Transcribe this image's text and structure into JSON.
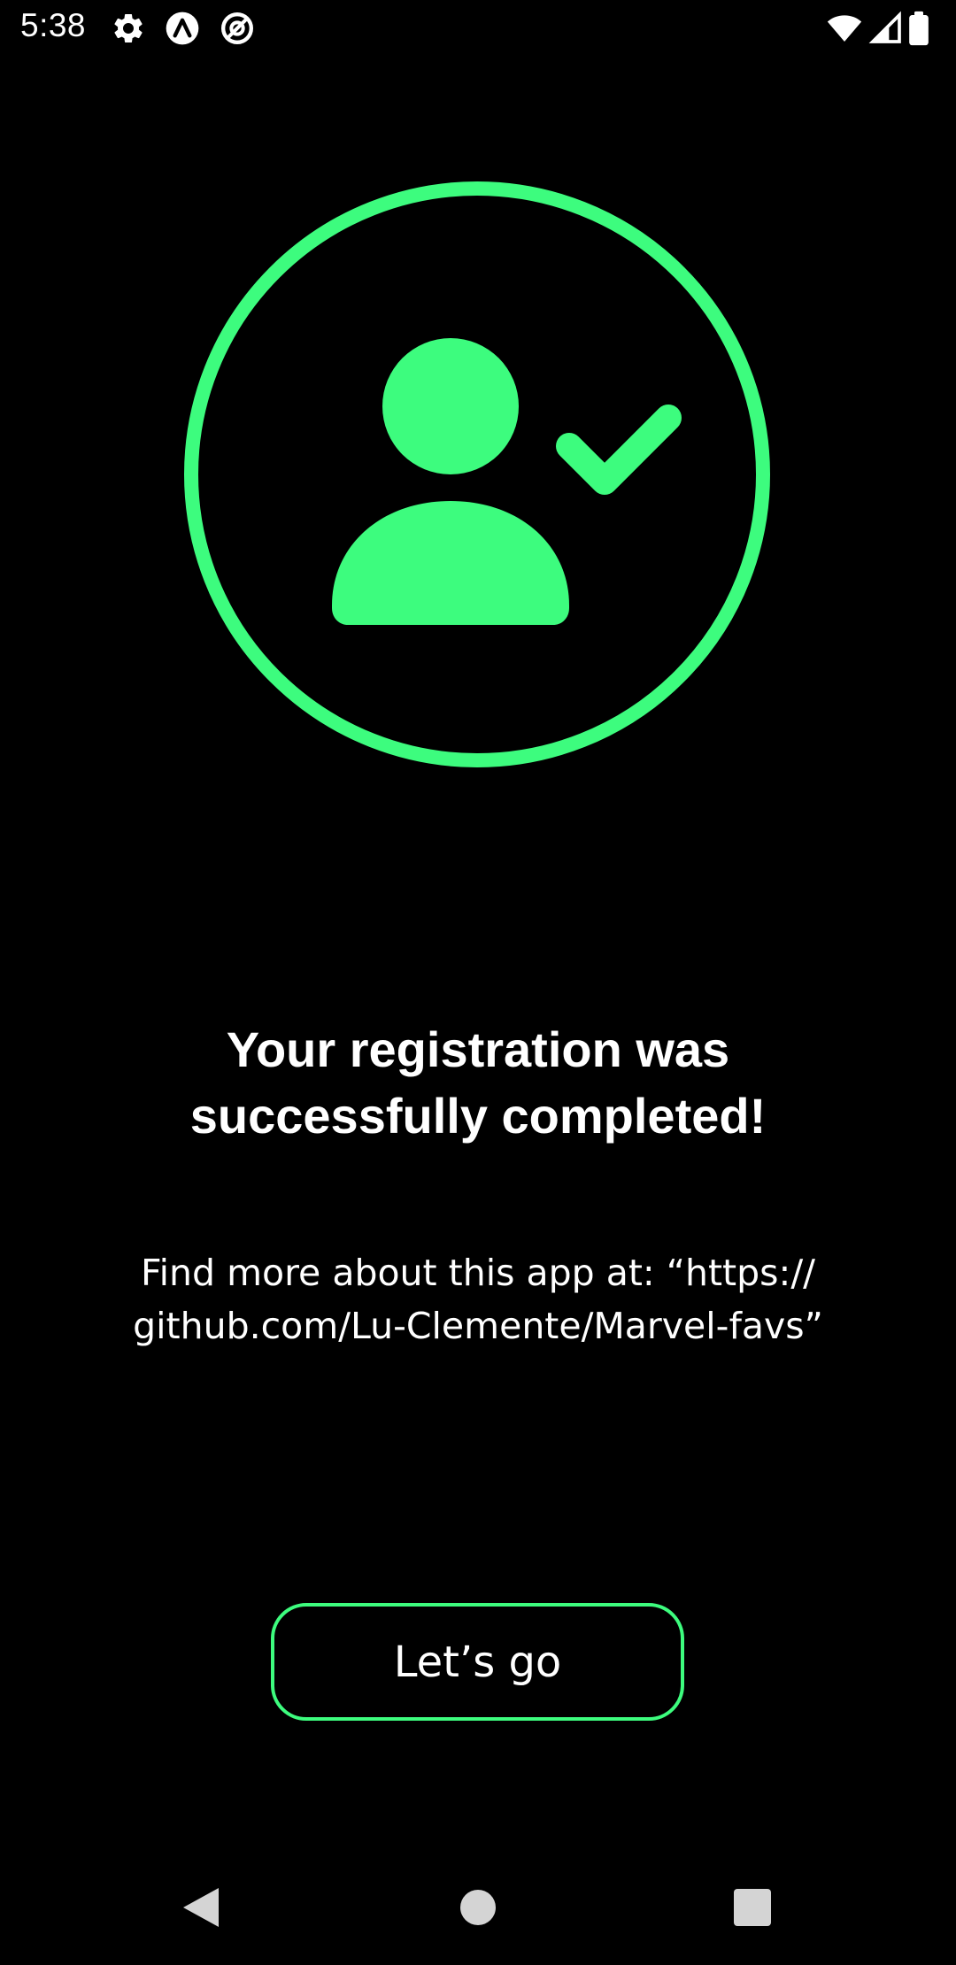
{
  "status_bar": {
    "time": "5:38",
    "left_icons": [
      "gear-icon",
      "app-a-icon",
      "app-at-icon"
    ],
    "right_icons": [
      "wifi-icon",
      "signal-icon",
      "battery-icon"
    ]
  },
  "hero": {
    "icon": "user-check-icon",
    "accent_color": "#3dfc7e"
  },
  "title": {
    "line1": "Your registration was",
    "line2": "successfully completed!"
  },
  "subtitle": {
    "line1": "Find more about this app at: “https://",
    "line2": "github.com/Lu-Clemente/Marvel-favs”"
  },
  "cta": {
    "label": "Let’s go"
  },
  "nav_bar": {
    "back": "back-icon",
    "home": "home-icon",
    "recents": "recents-icon"
  },
  "colors": {
    "background": "#000000",
    "accent": "#3dfc7e",
    "text": "#ffffff",
    "nav_icons": "#d4d4d4"
  }
}
